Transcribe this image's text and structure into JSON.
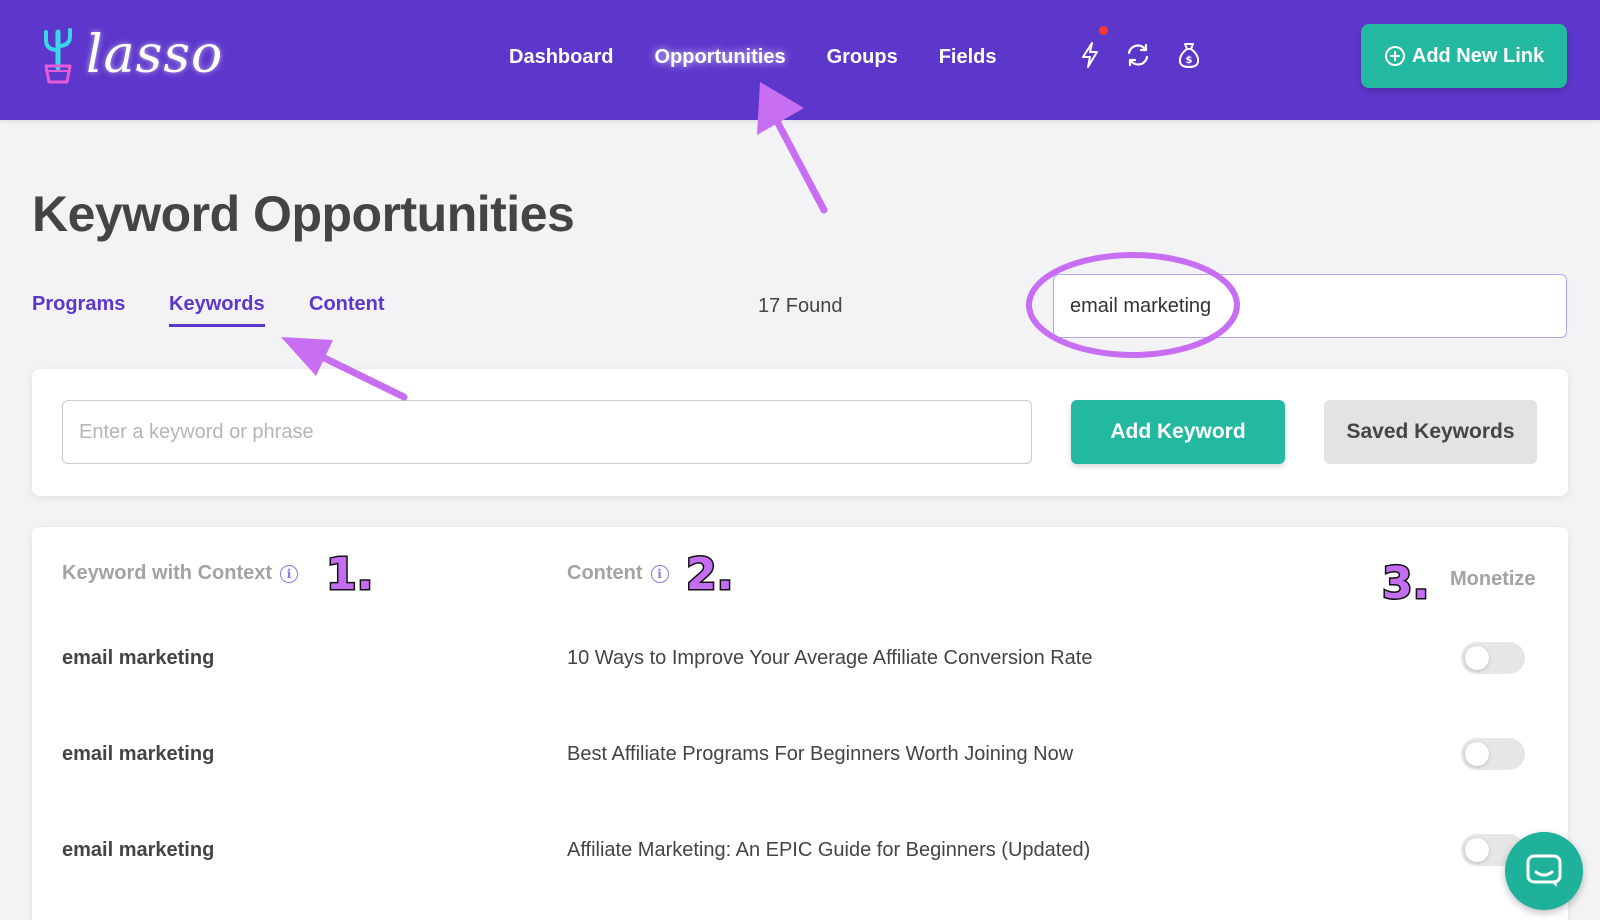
{
  "app": {
    "logo_text": "lasso",
    "nav": [
      {
        "label": "Dashboard",
        "active": false
      },
      {
        "label": "Opportunities",
        "active": true
      },
      {
        "label": "Groups",
        "active": false
      },
      {
        "label": "Fields",
        "active": false
      }
    ],
    "header_icons": [
      "lightning-icon",
      "refresh-icon",
      "money-bag-icon"
    ],
    "add_link_label": "Add New Link",
    "brand_color": "#5d37cc",
    "accent_color": "#22b9a0"
  },
  "page": {
    "title": "Keyword Opportunities",
    "tabs": [
      {
        "label": "Programs",
        "active": false
      },
      {
        "label": "Keywords",
        "active": true
      },
      {
        "label": "Content",
        "active": false
      }
    ],
    "found_text": "17 Found",
    "search_value": "email marketing"
  },
  "keyword_form": {
    "placeholder": "Enter a keyword or phrase",
    "add_label": "Add Keyword",
    "saved_label": "Saved Keywords"
  },
  "table": {
    "headers": {
      "keyword": "Keyword with Context",
      "content": "Content",
      "monetize": "Monetize"
    },
    "annotations": [
      "1.",
      "2.",
      "3."
    ],
    "rows": [
      {
        "keyword": "email marketing",
        "content": "10 Ways to Improve Your Average Affiliate Conversion Rate",
        "monetize": false
      },
      {
        "keyword": "email marketing",
        "content": "Best Affiliate Programs For Beginners Worth Joining Now",
        "monetize": false
      },
      {
        "keyword": "email marketing",
        "content": "Affiliate Marketing: An EPIC Guide for Beginners (Updated)",
        "monetize": false
      }
    ]
  }
}
